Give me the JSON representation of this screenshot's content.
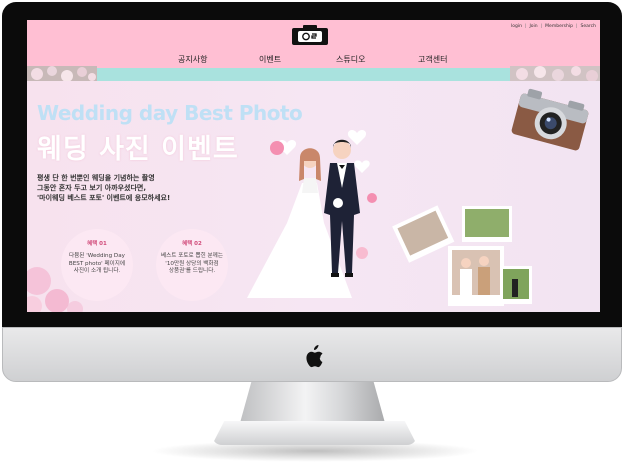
{
  "header": {
    "utility_links": [
      "login",
      "Join",
      "Membership",
      "Search"
    ],
    "nav": [
      "공지사항",
      "이벤트",
      "스튜디오",
      "고객센터"
    ]
  },
  "hero": {
    "title_en": "Wedding day Best Photo",
    "title_kr": "웨딩 사진 이벤트",
    "description": [
      "평생 단 한 번뿐인 웨딩을 기념하는 촬영",
      "그동안 혼자 두고 보기 아까우셨다면,",
      "'마이웨딩 베스트 포토' 이벤트에 응모하세요!"
    ],
    "benefits": [
      {
        "tag": "혜택 01",
        "lines": [
          "다뮴된 'Wedding Day",
          "BEST photo' 페이지에",
          "사진이 소개 됩니다."
        ]
      },
      {
        "tag": "혜택 02",
        "lines": [
          "베스트 포토로 뽑힌 분께는",
          "'10만원 상당의 백화점",
          "상품권'를 드립니다."
        ]
      }
    ]
  },
  "icons": {
    "logo": "camera-logo-icon",
    "apple": "apple-logo-icon"
  },
  "colors": {
    "header_pink": "#ffbfd3",
    "strip_mint": "#a9e2de",
    "hero_bg": "#f7e2ee",
    "title_en": "#bfe0f5",
    "accent": "#d14c7b"
  }
}
